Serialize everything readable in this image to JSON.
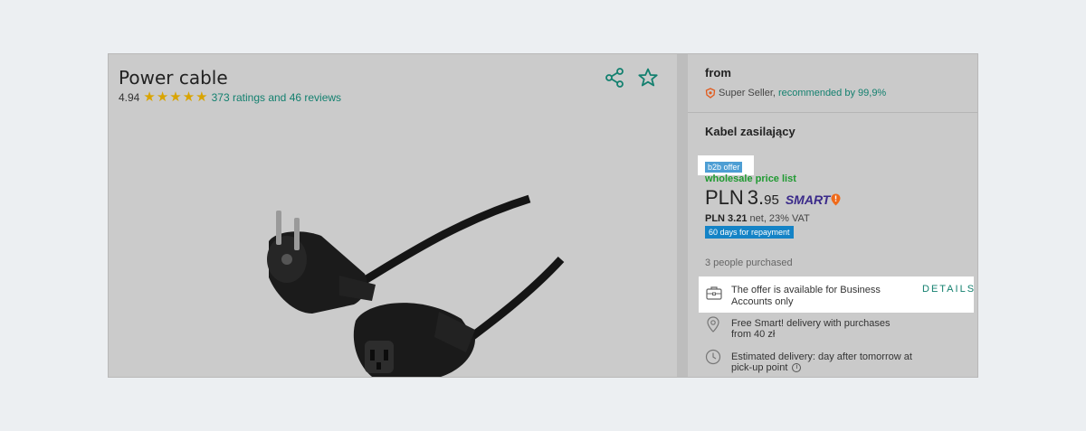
{
  "product": {
    "title": "Power cable",
    "rating": "4.94",
    "stars": 5,
    "reviews_text": "373 ratings and 46 reviews"
  },
  "actions": {
    "share_icon": "share-icon",
    "favorite_icon": "star-outline-icon"
  },
  "offer": {
    "from_label": "from",
    "seller_badge": "Super Seller,",
    "seller_recommended": "recommended by 99,9%",
    "product_name": "Kabel zasilający",
    "b2b_badge": "b2b offer",
    "wholesale_label": "wholesale price list",
    "price_currency": "PLN",
    "price_int": "3.",
    "price_dec": "95",
    "smart_label": "SMART",
    "net_price": "PLN 3.21",
    "net_suffix": "net, 23% VAT",
    "repayment_badge": "60 days for repayment",
    "purchased_text": "3 people purchased",
    "business_text": "The offer is available for Business Accounts only",
    "details_link": "DETAILS",
    "delivery_text": "Free Smart! delivery with purchases from 40 zł",
    "estimate_text": "Estimated delivery: day after tomorrow at pick-up point"
  },
  "colors": {
    "accent": "#13806f",
    "star": "#d9a400",
    "b2b": "#4d9ed4",
    "repayment": "#1483c6",
    "wholesale": "#1f9a31",
    "smart": "#3a2a8a"
  }
}
